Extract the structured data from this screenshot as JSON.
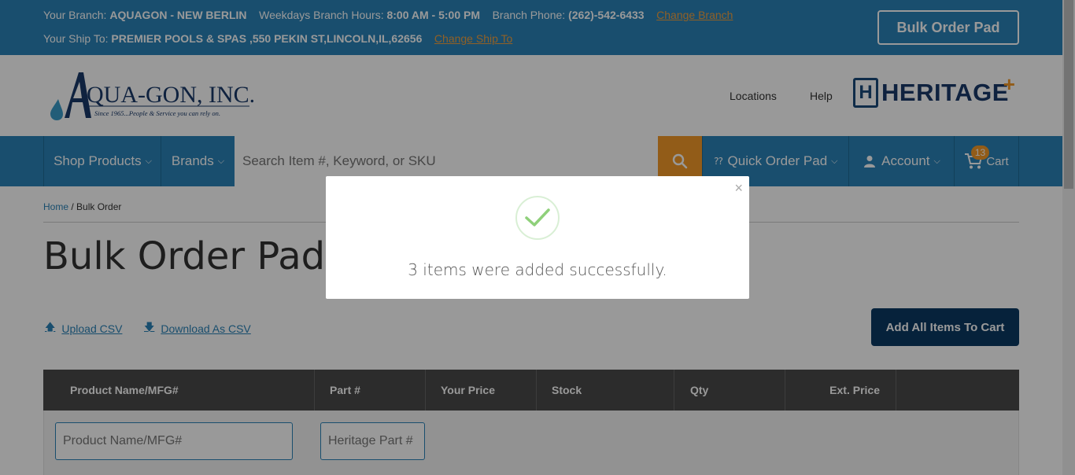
{
  "topbar": {
    "branch_label": "Your Branch:",
    "branch_value": "AQUAGON - NEW BERLIN",
    "hours_label": "Weekdays Branch Hours:",
    "hours_value": "8:00 AM - 5:00 PM",
    "phone_label": "Branch Phone:",
    "phone_value": "(262)-542-6433",
    "change_branch": "Change Branch",
    "shipto_label": "Your Ship To:",
    "shipto_value": "PREMIER POOLS & SPAS ,550 PEKIN ST,LINCOLN,IL,62656",
    "change_shipto": "Change Ship To",
    "bulk_button": "Bulk Order Pad"
  },
  "header": {
    "logo_name": "QUA-GON, INC.",
    "logo_tagline": "Since 1965...People & Service you can rely on.",
    "locations": "Locations",
    "help": "Help",
    "heritage": "HERITAGE",
    "heritage_mark": "H",
    "heritage_plus": "+"
  },
  "nav": {
    "shop_products": "Shop Products",
    "brands": "Brands",
    "search_placeholder": "Search Item #, Keyword, or SKU",
    "quick_order": "Quick Order Pad",
    "account": "Account",
    "cart": "Cart",
    "cart_count": "13"
  },
  "breadcrumb": {
    "home": "Home",
    "separator": "/",
    "current": "Bulk Order"
  },
  "page": {
    "title": "Bulk Order Pad",
    "upload_csv": "Upload CSV",
    "download_csv": "Download As CSV",
    "add_all": "Add All Items To Cart"
  },
  "table": {
    "columns": [
      "Product Name/MFG#",
      "Part #",
      "Your Price",
      "Stock",
      "Qty",
      "Ext. Price"
    ],
    "product_placeholder": "Product Name/MFG#",
    "part_placeholder": "Heritage Part #"
  },
  "modal": {
    "message": "3 items were added successfully.",
    "close": "×"
  },
  "colors": {
    "brand_blue": "#2b83b7",
    "accent_orange": "#f39a28",
    "dark_navy": "#0b3a63",
    "success_green": "#8fd07a"
  }
}
